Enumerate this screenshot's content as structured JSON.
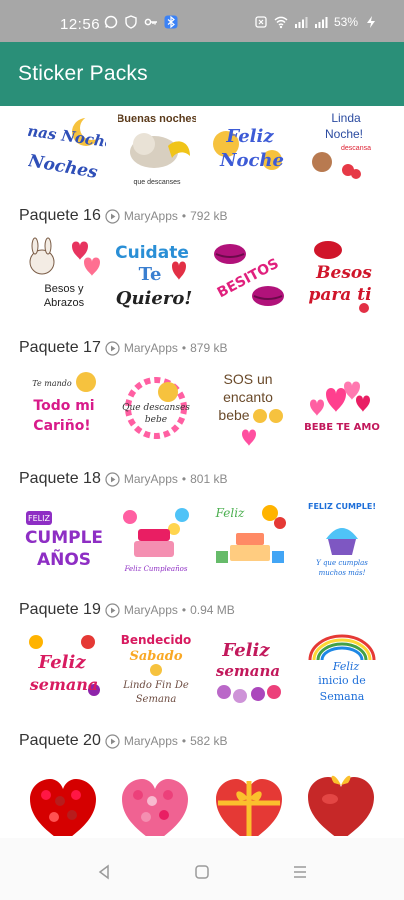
{
  "status_bar": {
    "time": "12:56",
    "battery": "53%"
  },
  "app_bar": {
    "title": "Sticker Packs"
  },
  "top_row": {
    "stickers": [
      {
        "text": "Buenas Noches",
        "icon": "moon-sticker"
      },
      {
        "text": "Buenas noches",
        "icon": "sleeping-cat-sticker"
      },
      {
        "text": "Feliz Noche",
        "icon": "moon-face-sticker"
      },
      {
        "text": "Linda Noche! descansa",
        "icon": "bear-hearts-sticker"
      }
    ]
  },
  "packs": [
    {
      "name": "Paquete 16",
      "author": "MaryApps",
      "size": "792 kB",
      "stickers": [
        {
          "text": "Besos y Abrazos",
          "icon": "bunny-hearts-sticker"
        },
        {
          "text": "Cuidate Te Quiero!",
          "icon": "cuidate-sticker"
        },
        {
          "text": "BESITOS",
          "icon": "lips-sticker"
        },
        {
          "text": "Besos para ti",
          "icon": "kiss-emoji-sticker"
        }
      ]
    },
    {
      "name": "Paquete 17",
      "author": "MaryApps",
      "size": "879 kB",
      "stickers": [
        {
          "text": "Todo mi Cariño!",
          "icon": "heart-emoji-sticker"
        },
        {
          "text": "Que descanses bebe",
          "icon": "hearts-ring-sticker"
        },
        {
          "text": "SOS un encanto bebe",
          "icon": "encanto-sticker"
        },
        {
          "text": "BEBE TE AMO",
          "icon": "hearts-cluster-sticker"
        }
      ]
    },
    {
      "name": "Paquete 18",
      "author": "MaryApps",
      "size": "801 kB",
      "stickers": [
        {
          "text": "FELIZ CUMPLE AÑOS",
          "icon": "birthday-text-sticker"
        },
        {
          "text": "Feliz Cumpleaños",
          "icon": "cake-balloons-sticker"
        },
        {
          "text": "Feliz Cumpleaños",
          "icon": "cake-gifts-sticker"
        },
        {
          "text": "FELIZ CUMPLE! Y que cumplas muchos más!",
          "icon": "cupcake-sticker"
        }
      ]
    },
    {
      "name": "Paquete 19",
      "author": "MaryApps",
      "size": "0.94 MB",
      "stickers": [
        {
          "text": "Feliz semana",
          "icon": "flowers-sticker"
        },
        {
          "text": "Bendecido Sabado Lindo Fin De Semana",
          "icon": "sabado-sticker"
        },
        {
          "text": "Feliz semana",
          "icon": "purple-flowers-sticker"
        },
        {
          "text": "Feliz inicio de Semana",
          "icon": "rainbow-sticker"
        }
      ]
    },
    {
      "name": "Paquete 20",
      "author": "MaryApps",
      "size": "582 kB",
      "stickers": [
        {
          "text": "",
          "icon": "rose-heart-sticker"
        },
        {
          "text": "",
          "icon": "pink-rose-heart-sticker"
        },
        {
          "text": "",
          "icon": "gold-bow-heart-sticker"
        },
        {
          "text": "",
          "icon": "red-gift-heart-sticker"
        }
      ]
    }
  ],
  "separator": "•",
  "colors": {
    "app_bar": "#2a8f78",
    "status_bar": "#a7a7a7",
    "meta_text": "#8a8a8a"
  }
}
